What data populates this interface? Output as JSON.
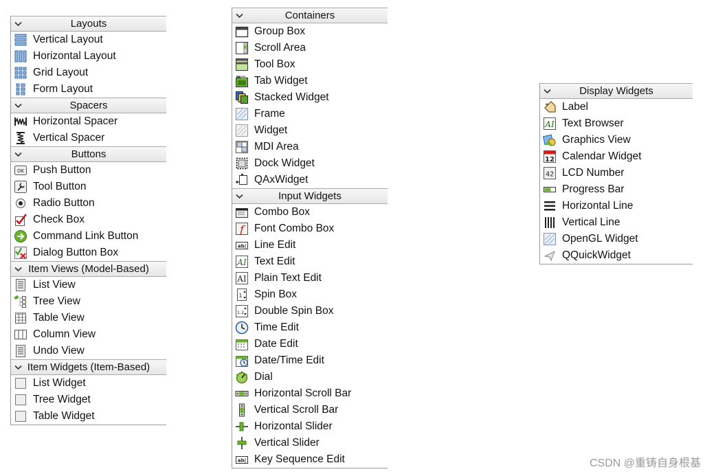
{
  "panels": [
    {
      "categories": [
        {
          "title": "Layouts",
          "items": [
            {
              "label": "Vertical Layout",
              "icon": "vertical-layout-icon"
            },
            {
              "label": "Horizontal Layout",
              "icon": "horizontal-layout-icon"
            },
            {
              "label": "Grid Layout",
              "icon": "grid-layout-icon"
            },
            {
              "label": "Form Layout",
              "icon": "form-layout-icon"
            }
          ]
        },
        {
          "title": "Spacers",
          "items": [
            {
              "label": "Horizontal Spacer",
              "icon": "horizontal-spacer-icon"
            },
            {
              "label": "Vertical Spacer",
              "icon": "vertical-spacer-icon"
            }
          ]
        },
        {
          "title": "Buttons",
          "items": [
            {
              "label": "Push Button",
              "icon": "push-button-icon"
            },
            {
              "label": "Tool Button",
              "icon": "tool-button-icon"
            },
            {
              "label": "Radio Button",
              "icon": "radio-button-icon"
            },
            {
              "label": "Check Box",
              "icon": "check-box-icon"
            },
            {
              "label": "Command Link Button",
              "icon": "command-link-icon"
            },
            {
              "label": "Dialog Button Box",
              "icon": "dialog-button-box-icon"
            }
          ]
        },
        {
          "title": "Item Views (Model-Based)",
          "items": [
            {
              "label": "List View",
              "icon": "list-view-icon"
            },
            {
              "label": "Tree View",
              "icon": "tree-view-icon"
            },
            {
              "label": "Table View",
              "icon": "table-view-icon"
            },
            {
              "label": "Column View",
              "icon": "column-view-icon"
            },
            {
              "label": "Undo View",
              "icon": "undo-view-icon"
            }
          ]
        },
        {
          "title": "Item Widgets (Item-Based)",
          "items": [
            {
              "label": "List Widget",
              "icon": "list-widget-icon"
            },
            {
              "label": "Tree Widget",
              "icon": "tree-widget-icon"
            },
            {
              "label": "Table Widget",
              "icon": "table-widget-icon"
            }
          ]
        }
      ]
    },
    {
      "categories": [
        {
          "title": "Containers",
          "items": [
            {
              "label": "Group Box",
              "icon": "group-box-icon"
            },
            {
              "label": "Scroll Area",
              "icon": "scroll-area-icon"
            },
            {
              "label": "Tool Box",
              "icon": "tool-box-icon"
            },
            {
              "label": "Tab Widget",
              "icon": "tab-widget-icon"
            },
            {
              "label": "Stacked Widget",
              "icon": "stacked-widget-icon"
            },
            {
              "label": "Frame",
              "icon": "frame-icon"
            },
            {
              "label": "Widget",
              "icon": "widget-icon"
            },
            {
              "label": "MDI Area",
              "icon": "mdi-area-icon"
            },
            {
              "label": "Dock Widget",
              "icon": "dock-widget-icon"
            },
            {
              "label": "QAxWidget",
              "icon": "qaxwidget-icon"
            }
          ]
        },
        {
          "title": "Input Widgets",
          "items": [
            {
              "label": "Combo Box",
              "icon": "combo-box-icon"
            },
            {
              "label": "Font Combo Box",
              "icon": "font-combo-box-icon"
            },
            {
              "label": "Line Edit",
              "icon": "line-edit-icon"
            },
            {
              "label": "Text Edit",
              "icon": "text-edit-icon"
            },
            {
              "label": "Plain Text Edit",
              "icon": "plain-text-edit-icon"
            },
            {
              "label": "Spin Box",
              "icon": "spin-box-icon"
            },
            {
              "label": "Double Spin Box",
              "icon": "double-spin-box-icon"
            },
            {
              "label": "Time Edit",
              "icon": "time-edit-icon"
            },
            {
              "label": "Date Edit",
              "icon": "date-edit-icon"
            },
            {
              "label": "Date/Time Edit",
              "icon": "date-time-edit-icon"
            },
            {
              "label": "Dial",
              "icon": "dial-icon"
            },
            {
              "label": "Horizontal Scroll Bar",
              "icon": "horizontal-scroll-bar-icon"
            },
            {
              "label": "Vertical Scroll Bar",
              "icon": "vertical-scroll-bar-icon"
            },
            {
              "label": "Horizontal Slider",
              "icon": "horizontal-slider-icon"
            },
            {
              "label": "Vertical Slider",
              "icon": "vertical-slider-icon"
            },
            {
              "label": "Key Sequence Edit",
              "icon": "key-sequence-edit-icon"
            }
          ]
        }
      ]
    },
    {
      "categories": [
        {
          "title": "Display Widgets",
          "items": [
            {
              "label": "Label",
              "icon": "label-icon"
            },
            {
              "label": "Text Browser",
              "icon": "text-browser-icon"
            },
            {
              "label": "Graphics View",
              "icon": "graphics-view-icon"
            },
            {
              "label": "Calendar Widget",
              "icon": "calendar-widget-icon"
            },
            {
              "label": "LCD Number",
              "icon": "lcd-number-icon"
            },
            {
              "label": "Progress Bar",
              "icon": "progress-bar-icon"
            },
            {
              "label": "Horizontal Line",
              "icon": "horizontal-line-icon"
            },
            {
              "label": "Vertical Line",
              "icon": "vertical-line-icon"
            },
            {
              "label": "OpenGL Widget",
              "icon": "opengl-widget-icon"
            },
            {
              "label": "QQuickWidget",
              "icon": "qquickwidget-icon"
            }
          ]
        }
      ]
    }
  ],
  "watermark": "CSDN @重铸自身根基"
}
